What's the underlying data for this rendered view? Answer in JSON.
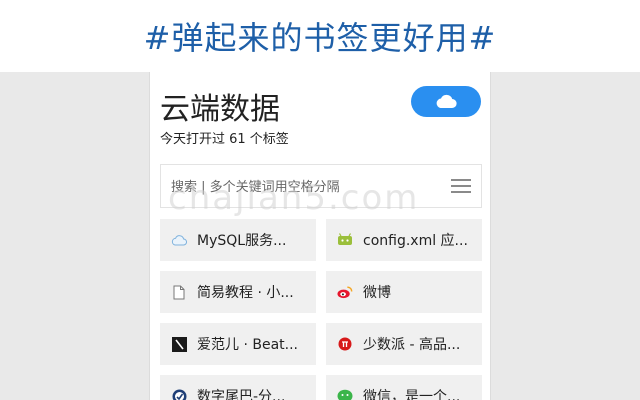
{
  "banner": {
    "text": "#弹起来的书签更好用#"
  },
  "popup": {
    "title": "云端数据",
    "subtitle": "今天打开过 61 个标签",
    "sync_button": {
      "icon": "cloud-icon",
      "color": "#2a8ff0"
    },
    "search": {
      "placeholder": "搜索 | 多个关键词用空格分隔",
      "value": ""
    }
  },
  "watermark": {
    "text": "chajian5.com"
  },
  "bookmarks": [
    {
      "label": "MySQL服务...",
      "icon": "cloud-outline-icon"
    },
    {
      "label": "config.xml 应...",
      "icon": "android-icon"
    },
    {
      "label": "简易教程 · 小...",
      "icon": "document-icon"
    },
    {
      "label": "微博",
      "icon": "weibo-icon"
    },
    {
      "label": "爱范儿 · Beat...",
      "icon": "ifanr-icon"
    },
    {
      "label": "少数派 - 高品...",
      "icon": "sspai-icon"
    },
    {
      "label": "数字尾巴-分...",
      "icon": "dgtle-icon"
    },
    {
      "label": "微信，是一个...",
      "icon": "wechat-icon"
    }
  ],
  "colors": {
    "banner_text": "#1e5fa8",
    "accent": "#2a8ff0",
    "tile_bg": "#f0f0f0"
  }
}
